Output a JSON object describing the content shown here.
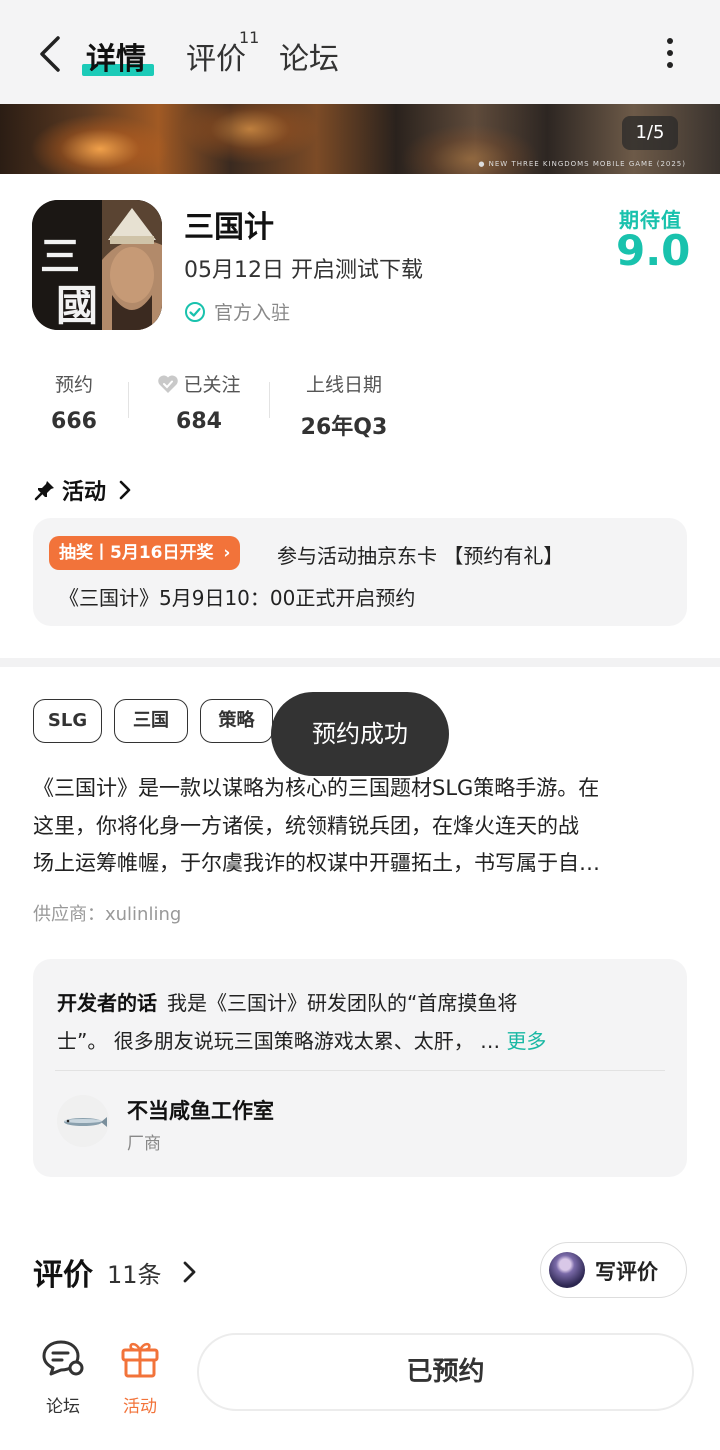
{
  "header": {
    "tabs": [
      {
        "label": "详情",
        "active": true
      },
      {
        "label": "评价",
        "badge": "11"
      },
      {
        "label": "论坛"
      }
    ],
    "accent_color": "#1ccbb8"
  },
  "banner": {
    "counter": "1/5",
    "caption": "● NEW THREE KINGDOMS MOBILE GAME (2025)"
  },
  "app": {
    "icon_text": "三國",
    "title": "三国计",
    "subtitle": "05月12日 开启测试下载",
    "official": "官方入驻",
    "expect_label": "期待值",
    "expect_value": "9.0"
  },
  "stats": [
    {
      "label": "预约",
      "value": "666"
    },
    {
      "label": "已关注",
      "value": "684",
      "icon": "heart-check-icon"
    },
    {
      "label": "上线日期",
      "value": "26年Q3"
    }
  ],
  "activity": {
    "heading": "活动",
    "tag": "抽奖丨5月16日开奖",
    "line1": "参与活动抽京东卡 【预约有礼】",
    "line2": "《三国计》5月9日10：00正式开启预约"
  },
  "tags": [
    "SLG",
    "三国",
    "策略"
  ],
  "toast": "预约成功",
  "description": {
    "lines": [
      "《三国计》是一款以谋略为核心的三国题材SLG策略手游。在",
      "这里，你将化身一方诸侯，统领精锐兵团，在烽火连天的战",
      "场上运筹帷幄，于尔虞我诈的权谋中开疆拓土，书写属于自…"
    ],
    "supplier": "供应商：xulinling"
  },
  "developer": {
    "heading": "开发者的话",
    "line1": "我是《三国计》研发团队的“首席摸鱼将",
    "line2": "士”。 很多朋友说玩三国策略游戏太累、太肝， …",
    "more": "更多",
    "studio_name": "不当咸鱼工作室",
    "studio_role": "厂商"
  },
  "reviews": {
    "title": "评价",
    "count": "11条",
    "write": "写评价"
  },
  "bottom_nav": {
    "forum": "论坛",
    "activity": "活动",
    "reserved": "已预约",
    "activity_color": "#f2733a"
  }
}
